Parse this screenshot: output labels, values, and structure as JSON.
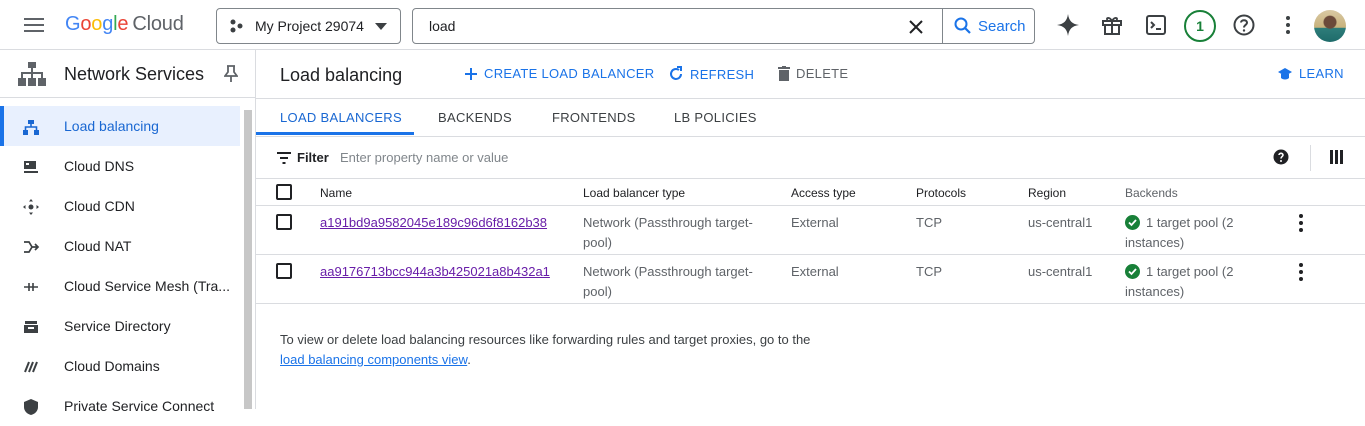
{
  "header": {
    "logo_google": "Google",
    "logo_cloud": "Cloud",
    "project_name": "My Project 29074",
    "search_value": "load",
    "search_button": "Search",
    "notification_count": "1"
  },
  "sidebar": {
    "title": "Network Services",
    "items": [
      {
        "label": "Load balancing",
        "icon": "load-balancing-icon",
        "active": true
      },
      {
        "label": "Cloud DNS",
        "icon": "cloud-dns-icon"
      },
      {
        "label": "Cloud CDN",
        "icon": "cloud-cdn-icon"
      },
      {
        "label": "Cloud NAT",
        "icon": "cloud-nat-icon"
      },
      {
        "label": "Cloud Service Mesh (Tra...",
        "icon": "service-mesh-icon"
      },
      {
        "label": "Service Directory",
        "icon": "service-directory-icon"
      },
      {
        "label": "Cloud Domains",
        "icon": "cloud-domains-icon"
      },
      {
        "label": "Private Service Connect",
        "icon": "private-service-connect-icon"
      }
    ]
  },
  "main": {
    "title": "Load balancing",
    "actions": {
      "create": "CREATE LOAD BALANCER",
      "refresh": "REFRESH",
      "delete": "DELETE",
      "learn": "LEARN"
    },
    "tabs": [
      "LOAD BALANCERS",
      "BACKENDS",
      "FRONTENDS",
      "LB POLICIES"
    ],
    "filter": {
      "label": "Filter",
      "placeholder": "Enter property name or value"
    },
    "table": {
      "columns": [
        "Name",
        "Load balancer type",
        "Access type",
        "Protocols",
        "Region",
        "Backends"
      ],
      "rows": [
        {
          "name": "a191bd9a9582045e189c96d6f8162b38",
          "type": "Network (Passthrough target-pool)",
          "access": "External",
          "protocol": "TCP",
          "region": "us-central1",
          "backends": "1 target pool (2 instances)"
        },
        {
          "name": "aa9176713bcc944a3b425021a8b432a1",
          "type": "Network (Passthrough target-pool)",
          "access": "External",
          "protocol": "TCP",
          "region": "us-central1",
          "backends": "1 target pool (2 instances)"
        }
      ]
    },
    "footnote": {
      "text": "To view or delete load balancing resources like forwarding rules and target proxies, go to the ",
      "link": "load balancing components view",
      "end": "."
    }
  },
  "colors": {
    "accent": "#1a73e8",
    "visited_link": "#681da8",
    "success": "#188038",
    "active_nav_bg": "#e8f0fe"
  }
}
